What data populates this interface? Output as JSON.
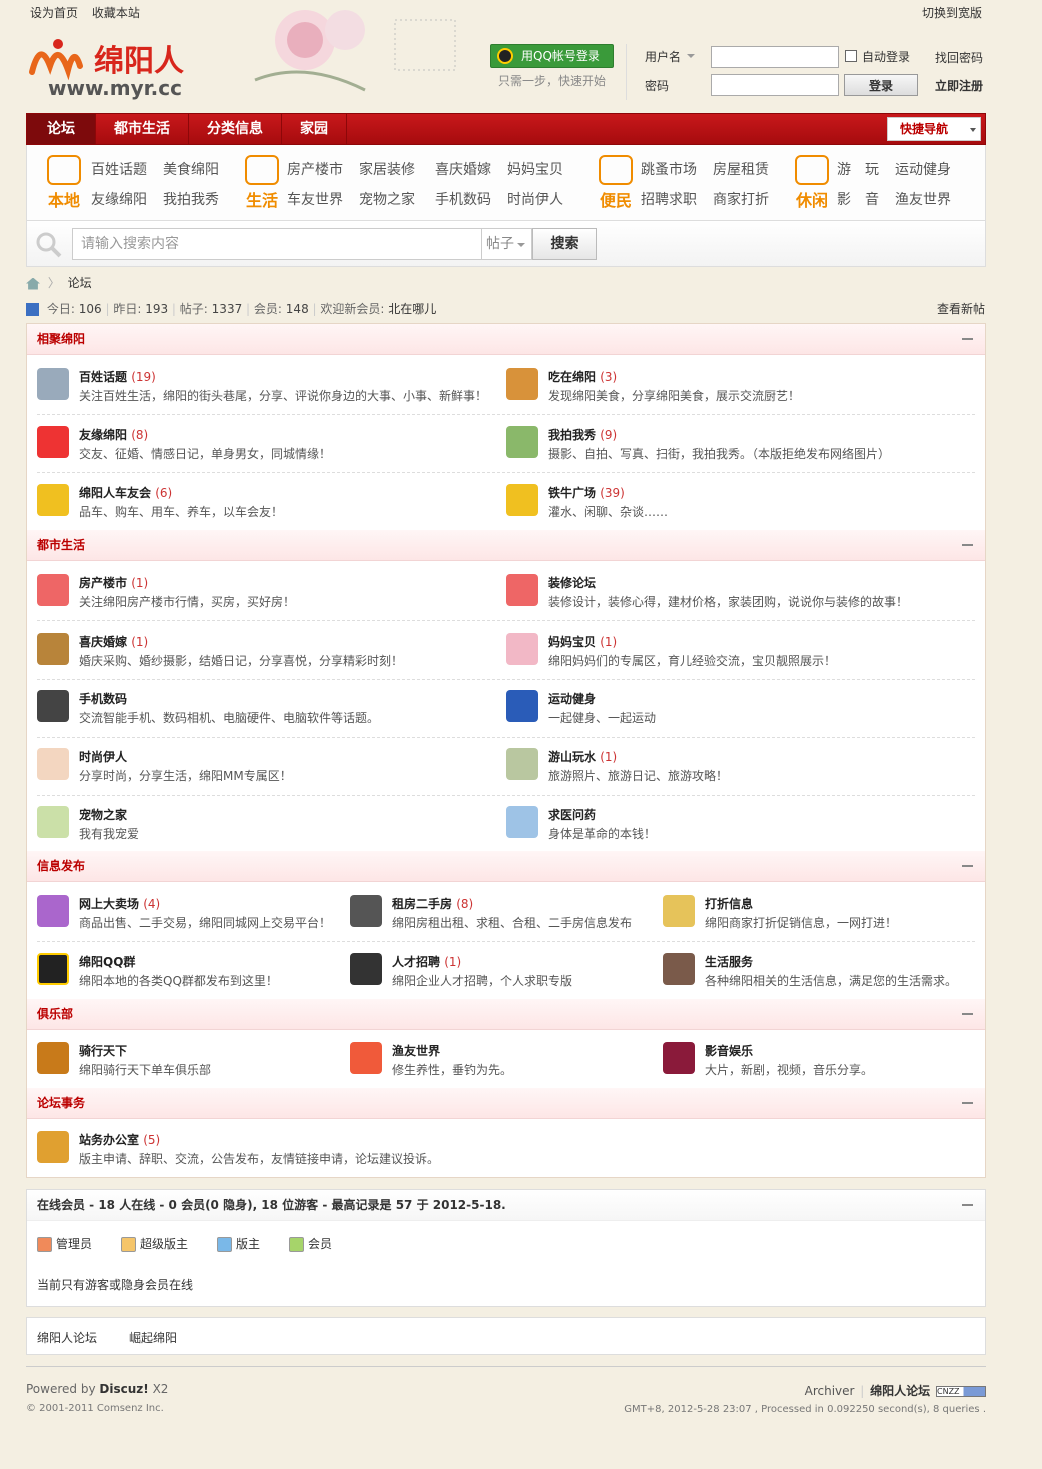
{
  "header": {
    "top_links": [
      "设为首页",
      "收藏本站"
    ],
    "switch_wide": "切换到宽版",
    "logo_text": "绵阳人",
    "logo_url": "www.myr.cc",
    "qq_login": "用QQ帐号登录",
    "qq_hint": "只需一步，快速开始",
    "username_label": "用户名",
    "password_label": "密码",
    "auto_login": "自动登录",
    "find_password": "找回密码",
    "login_button": "登录",
    "register": "立即注册"
  },
  "nav": {
    "items": [
      "论坛",
      "都市生活",
      "分类信息",
      "家园"
    ],
    "quick_nav": "快捷导航"
  },
  "subnav": {
    "groups": [
      {
        "name": "本地",
        "links": [
          "百姓话题",
          "美食绵阳",
          "友缘绵阳",
          "我拍我秀"
        ]
      },
      {
        "name": "生活",
        "links": [
          "房产楼市",
          "家居装修",
          "喜庆婚嫁",
          "妈妈宝贝",
          "车友世界",
          "宠物之家",
          "手机数码",
          "时尚伊人"
        ]
      },
      {
        "name": "便民",
        "links": [
          "跳蚤市场",
          "房屋租赁",
          "招聘求职",
          "商家打折"
        ]
      },
      {
        "name": "休闲",
        "links": [
          "游",
          "玩",
          "运动健身",
          "影",
          "音",
          "渔友世界"
        ]
      }
    ]
  },
  "search": {
    "placeholder": "请输入搜索内容",
    "type": "帖子",
    "button": "搜索"
  },
  "breadcrumb": "论坛",
  "stats": {
    "today_label": "今日:",
    "today": "106",
    "yesterday_label": "昨日:",
    "yesterday": "193",
    "posts_label": "帖子:",
    "posts": "1337",
    "members_label": "会员:",
    "members": "148",
    "welcome_label": "欢迎新会员:",
    "newest_member": "北在哪儿",
    "new_posts": "查看新帖"
  },
  "categories": [
    {
      "title": "相聚绵阳",
      "forums": [
        {
          "name": "百姓话题",
          "count": "(19)",
          "desc": "关注百姓生活，绵阳的街头巷尾，分享、评说你身边的大事、小事、新鲜事！"
        },
        {
          "name": "吃在绵阳",
          "count": "(3)",
          "desc": "发现绵阳美食，分享绵阳美食，展示交流厨艺！"
        },
        {
          "name": "友缘绵阳",
          "count": "(8)",
          "desc": "交友、征婚、情感日记，单身男女，同城情缘！"
        },
        {
          "name": "我拍我秀",
          "count": "(9)",
          "desc": "摄影、自拍、写真、扫街，我拍我秀。（本版拒绝发布网络图片）"
        },
        {
          "name": "绵阳人车友会",
          "count": "(6)",
          "desc": "品车、购车、用车、养车，以车会友！"
        },
        {
          "name": "铁牛广场",
          "count": "(39)",
          "desc": "灌水、闲聊、杂谈……"
        }
      ]
    },
    {
      "title": "都市生活",
      "forums": [
        {
          "name": "房产楼市",
          "count": "(1)",
          "desc": "关注绵阳房产楼市行情，买房，买好房！"
        },
        {
          "name": "装修论坛",
          "count": "",
          "desc": "装修设计，装修心得，建材价格，家装团购，说说你与装修的故事！"
        },
        {
          "name": "喜庆婚嫁",
          "count": "(1)",
          "desc": "婚庆采购、婚纱摄影，结婚日记，分享喜悦，分享精彩时刻！"
        },
        {
          "name": "妈妈宝贝",
          "count": "(1)",
          "desc": "绵阳妈妈们的专属区，育儿经验交流，宝贝靓照展示！"
        },
        {
          "name": "手机数码",
          "count": "",
          "desc": "交流智能手机、数码相机、电脑硬件、电脑软件等话题。"
        },
        {
          "name": "运动健身",
          "count": "",
          "desc": "一起健身、一起运动"
        },
        {
          "name": "时尚伊人",
          "count": "",
          "desc": "分享时尚，分享生活，绵阳MM专属区！"
        },
        {
          "name": "游山玩水",
          "count": "(1)",
          "desc": "旅游照片、旅游日记、旅游攻略！"
        },
        {
          "name": "宠物之家",
          "count": "",
          "desc": "我有我宠爱"
        },
        {
          "name": "求医问药",
          "count": "",
          "desc": "身体是革命的本钱！"
        }
      ]
    },
    {
      "title": "信息发布",
      "forums": [
        {
          "name": "网上大卖场",
          "count": "(4)",
          "desc": "商品出售、二手交易，绵阳同城网上交易平台！"
        },
        {
          "name": "租房二手房",
          "count": "(8)",
          "desc": "绵阳房租出租、求租、合租、二手房信息发布"
        },
        {
          "name": "打折信息",
          "count": "",
          "desc": "绵阳商家打折促销信息，一网打进！"
        },
        {
          "name": "绵阳QQ群",
          "count": "",
          "desc": "绵阳本地的各类QQ群都发布到这里！"
        },
        {
          "name": "人才招聘",
          "count": "(1)",
          "desc": "绵阳企业人才招聘，个人求职专版"
        },
        {
          "name": "生活服务",
          "count": "",
          "desc": "各种绵阳相关的生活信息，满足您的生活需求。"
        }
      ]
    },
    {
      "title": "俱乐部",
      "forums": [
        {
          "name": "骑行天下",
          "count": "",
          "desc": "绵阳骑行天下单车俱乐部"
        },
        {
          "name": "渔友世界",
          "count": "",
          "desc": "修生养性，垂钓为先。"
        },
        {
          "name": "影音娱乐",
          "count": "",
          "desc": "大片，新剧，视频，音乐分享。"
        }
      ]
    },
    {
      "title": "论坛事务",
      "forums": [
        {
          "name": "站务办公室",
          "count": "(5)",
          "desc": "版主申请、辞职、交流，公告发布，友情链接申请，论坛建议投诉。"
        }
      ]
    }
  ],
  "online": {
    "title": "在线会员 - 18 人在线 - 0 会员(0 隐身), 18 位游客 - 最高记录是 57 于 2012-5-18.",
    "legend": [
      "管理员",
      "超级版主",
      "版主",
      "会员"
    ],
    "note": "当前只有游客或隐身会员在线"
  },
  "links": [
    "绵阳人论坛",
    "崛起绵阳"
  ],
  "footer": {
    "powered_prefix": "Powered by",
    "powered_name": "Discuz!",
    "powered_ver": "X2",
    "copyright": "© 2001-2011 Comsenz Inc.",
    "archiver": "Archiver",
    "site_name": "绵阳人论坛",
    "badge": "CNZZ",
    "gmt": "GMT+8, 2012-5-28 23:07 , Processed in 0.092250 second(s), 8 queries ."
  },
  "colors": {
    "brand_red": "#c8181b",
    "accent_orange": "#f08c00",
    "count_red": "#cc3333"
  }
}
